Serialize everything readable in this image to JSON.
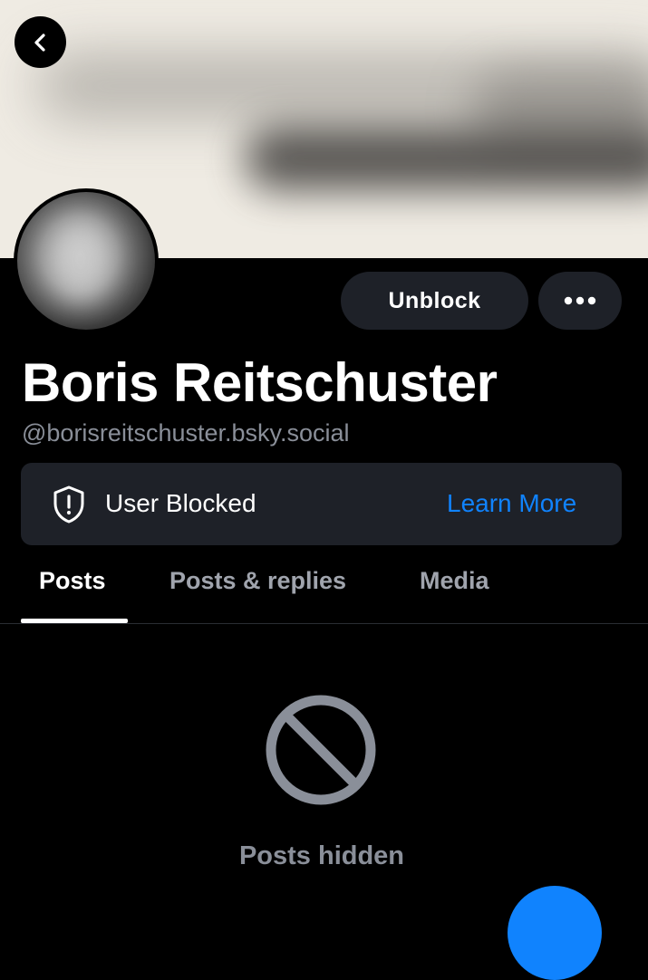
{
  "header": {
    "back_icon": "chevron-left-icon"
  },
  "profile": {
    "display_name": "Boris Reitschuster",
    "handle": "@borisreitschuster.bsky.social"
  },
  "actions": {
    "unblock_label": "Unblock",
    "more_icon": "ellipsis-icon"
  },
  "blocked_notice": {
    "icon": "shield-alert-icon",
    "text": "User Blocked",
    "link": "Learn More"
  },
  "tabs": [
    {
      "label": "Posts",
      "active": true
    },
    {
      "label": "Posts & replies",
      "active": false
    },
    {
      "label": "Media",
      "active": false
    }
  ],
  "feed": {
    "icon": "prohibited-icon",
    "empty_text": "Posts hidden"
  },
  "colors": {
    "background": "#000000",
    "surface": "#1e2128",
    "accent": "#1083fe",
    "muted_text": "#8a8f99"
  }
}
